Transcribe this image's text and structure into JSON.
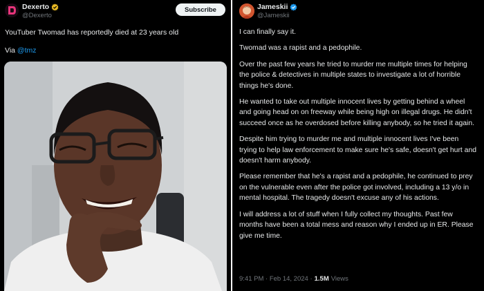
{
  "left_tweet": {
    "author_name": "Dexerto",
    "author_handle": "@Dexerto",
    "subscribe_label": "Subscribe",
    "text_line1": "YouTuber Twomad has reportedly died at 23 years old",
    "via_prefix": "Via",
    "via_link": "@tmz",
    "avatar_bg": "#e8347a",
    "badge_color": "#e8b923"
  },
  "right_tweet": {
    "author_name": "Jameskii",
    "author_handle": "@Jameskii",
    "badge_color": "#1d9bf0",
    "paragraphs": [
      "I can finally say it.",
      "Twomad was a rapist and a pedophile.",
      "Over the past few years he tried to murder me multiple times for helping the police & detectives in multiple states to investigate a lot of horrible things he's done.",
      "He wanted to take out multiple innocent lives by getting behind a wheel and going head on on freeway while being high on illegal drugs. He didn't succeed once as he overdosed before killing anybody, so he tried it again.",
      "Despite him trying to murder me and multiple innocent lives I've been trying to help law enforcement to make sure he's safe, doesn't get hurt and doesn't harm anybody.",
      "Please remember that he's a rapist and a pedophile, he continued to prey on the vulnerable even after the police got involved, including a 13 y/o in mental hospital. The tragedy doesn't excuse any of his actions.",
      "I will address a lot of stuff when I fully collect my thoughts. Past few months have been a total mess and  reason why I ended up in ER. Please give me time."
    ],
    "time": "9:41 PM · Feb 14, 2024 ·",
    "views_count": "1.5M",
    "views_label": "Views"
  }
}
